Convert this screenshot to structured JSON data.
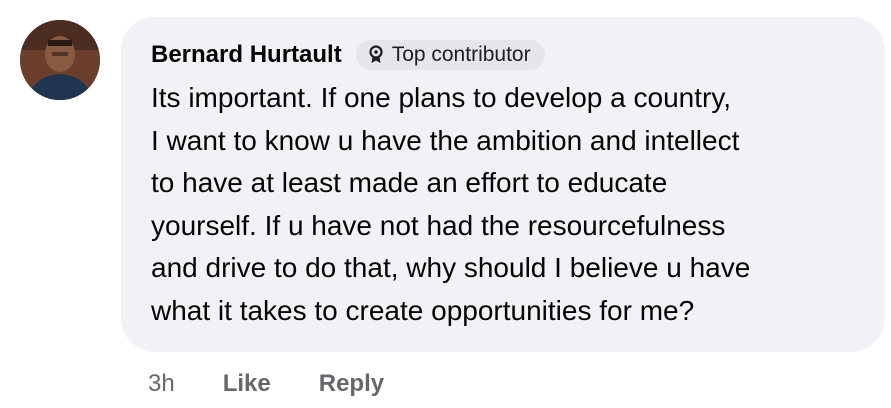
{
  "comment": {
    "author": "Bernard Hurtault",
    "badge": {
      "icon": "award-icon",
      "label": "Top contributor"
    },
    "text": "Its important. If one plans to develop a country,\nI want to know u have the ambition and intellect\nto have at least made an effort to educate\nyourself. If u have not had the resourcefulness\nand drive to do that, why should I believe u have\nwhat it takes to create opportunities for me?",
    "timestamp": "3h",
    "actions": {
      "like": "Like",
      "reply": "Reply"
    }
  },
  "colors": {
    "bubble": "#f0f2f5",
    "badge_bg": "#e4e6eb",
    "text": "#050505",
    "secondary": "#65676b"
  }
}
